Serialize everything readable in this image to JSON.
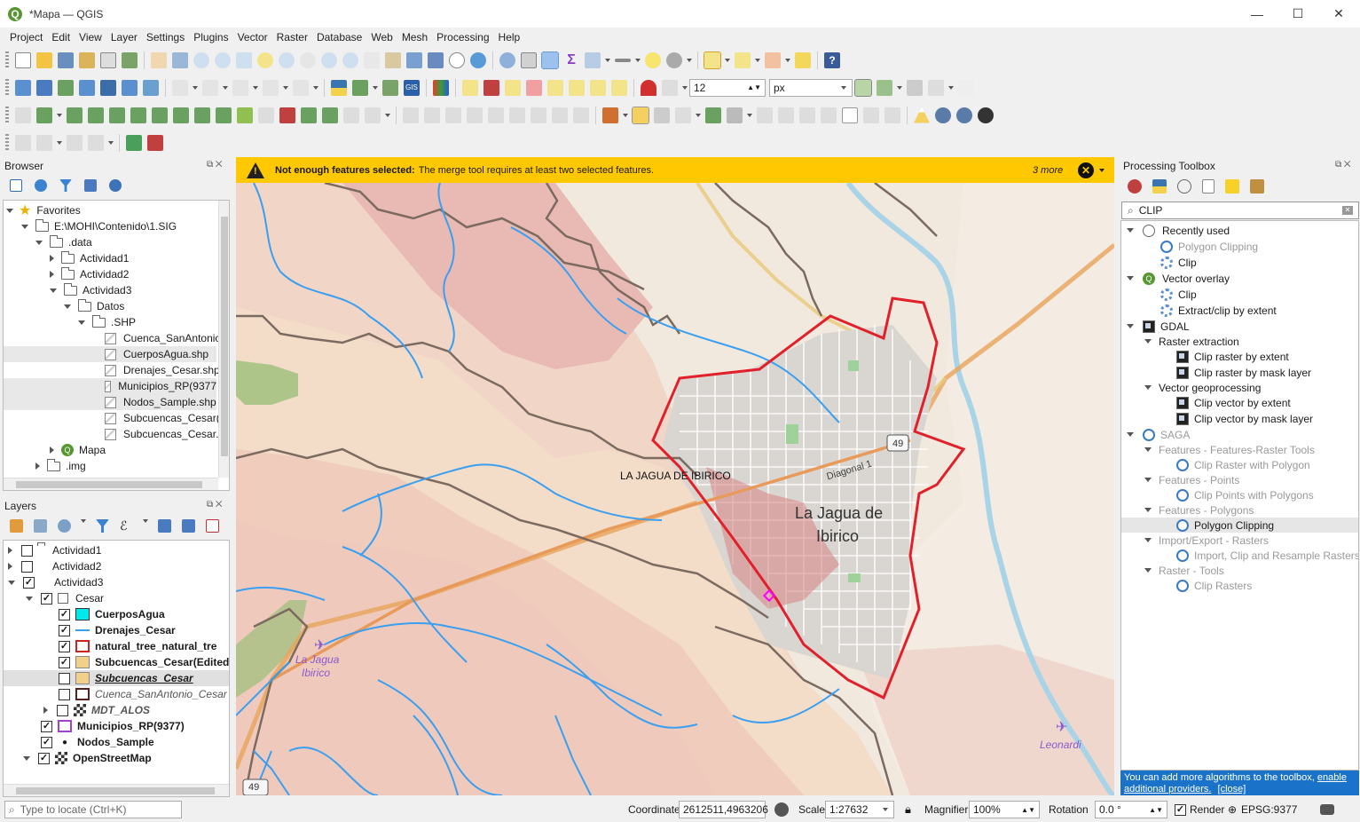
{
  "window": {
    "title": "*Mapa — QGIS"
  },
  "menu": [
    "Project",
    "Edit",
    "View",
    "Layer",
    "Settings",
    "Plugins",
    "Vector",
    "Raster",
    "Database",
    "Web",
    "Mesh",
    "Processing",
    "Help"
  ],
  "toolbar": {
    "font_size": "12",
    "font_unit": "px"
  },
  "browser": {
    "title": "Browser",
    "items": [
      {
        "label": "Favorites"
      },
      {
        "label": "E:\\MOHI\\Contenido\\1.SIG"
      },
      {
        "label": ".data"
      },
      {
        "label": "Actividad1"
      },
      {
        "label": "Actividad2"
      },
      {
        "label": "Actividad3"
      },
      {
        "label": "Datos"
      },
      {
        "label": ".SHP"
      },
      {
        "label": "Cuenca_SanAntonio"
      },
      {
        "label": "CuerposAgua.shp"
      },
      {
        "label": "Drenajes_Cesar.shp"
      },
      {
        "label": "Municipios_RP(9377"
      },
      {
        "label": "Nodos_Sample.shp"
      },
      {
        "label": "Subcuencas_Cesar(E"
      },
      {
        "label": "Subcuencas_Cesar.s"
      },
      {
        "label": "Mapa"
      },
      {
        "label": ".img"
      }
    ]
  },
  "layers": {
    "title": "Layers",
    "items": [
      {
        "label": "Actividad1"
      },
      {
        "label": "Actividad2"
      },
      {
        "label": "Actividad3"
      },
      {
        "label": "Cesar"
      },
      {
        "label": "CuerposAgua"
      },
      {
        "label": "Drenajes_Cesar"
      },
      {
        "label": "natural_tree_natural_tre"
      },
      {
        "label": "Subcuencas_Cesar(Edited)"
      },
      {
        "label": "Subcuencas_Cesar"
      },
      {
        "label": "Cuenca_SanAntonio_Cesar"
      },
      {
        "label": "MDT_ALOS"
      },
      {
        "label": "Municipios_RP(9377)"
      },
      {
        "label": "Nodos_Sample"
      },
      {
        "label": "OpenStreetMap"
      }
    ]
  },
  "message": {
    "title": "Not enough features selected:",
    "text": "The merge tool requires at least two selected features.",
    "more": "3 more"
  },
  "map": {
    "labels": {
      "town_label": "LA JAGUA DE IBIRICO",
      "city": "La Jagua de",
      "city2": "Ibirico",
      "road": "Diagonal 1",
      "shield": "49",
      "shield2": "49",
      "airport1": "La Jagua",
      "airport1b": "Ibirico",
      "airport2": "Leonardi"
    },
    "colors": {
      "boundary": "#e0202a",
      "river": "#3a9ff0",
      "basin": "#7a6a60"
    }
  },
  "toolbox": {
    "title": "Processing Toolbox",
    "search": "CLIP",
    "items": [
      {
        "label": "Recently used"
      },
      {
        "label": "Polygon Clipping"
      },
      {
        "label": "Clip"
      },
      {
        "label": "Vector overlay"
      },
      {
        "label": "Clip"
      },
      {
        "label": "Extract/clip by extent"
      },
      {
        "label": "GDAL"
      },
      {
        "label": "Raster extraction"
      },
      {
        "label": "Clip raster by extent"
      },
      {
        "label": "Clip raster by mask layer"
      },
      {
        "label": "Vector geoprocessing"
      },
      {
        "label": "Clip vector by extent"
      },
      {
        "label": "Clip vector by mask layer"
      },
      {
        "label": "SAGA"
      },
      {
        "label": "Features - Features-Raster Tools"
      },
      {
        "label": "Clip Raster with Polygon"
      },
      {
        "label": "Features - Points"
      },
      {
        "label": "Clip Points with Polygons"
      },
      {
        "label": "Features - Polygons"
      },
      {
        "label": "Polygon Clipping"
      },
      {
        "label": "Import/Export - Rasters"
      },
      {
        "label": "Import, Clip and Resample Rasters"
      },
      {
        "label": "Raster - Tools"
      },
      {
        "label": "Clip Rasters"
      }
    ],
    "footer": "You can add more algorithms to the toolbox,",
    "footer_link1": "enable additional providers.",
    "footer_link2": "[close]"
  },
  "status": {
    "locate_placeholder": "Type to locate (Ctrl+K)",
    "coordinate_label": "Coordinate",
    "coordinate": "2612511,4963206",
    "scale_label": "Scale",
    "scale": "1:27632",
    "magnifier_label": "Magnifier",
    "magnifier": "100%",
    "rotation_label": "Rotation",
    "rotation": "0.0 °",
    "render_label": "Render",
    "crs": "EPSG:9377"
  }
}
